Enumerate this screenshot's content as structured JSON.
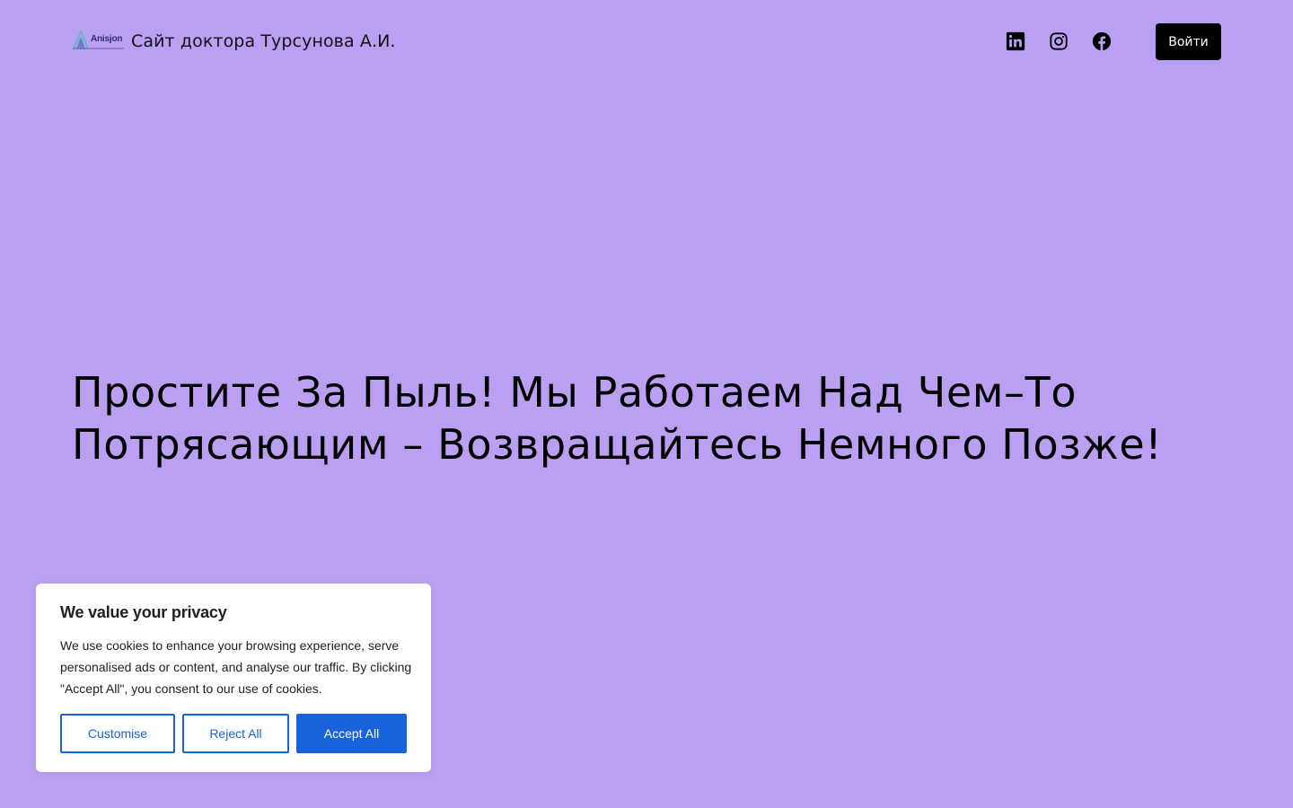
{
  "header": {
    "logo_text": "Anisjon",
    "site_title": "Сайт доктора Турсунова А.И.",
    "social": [
      {
        "icon": "linkedin-icon"
      },
      {
        "icon": "instagram-icon"
      },
      {
        "icon": "facebook-icon"
      }
    ],
    "login_label": "Войти"
  },
  "hero": {
    "heading": "Простите За Пыль! Мы Работаем Над Чем–То Потрясающим – Возвращайтесь Немного Позже!"
  },
  "cookie_banner": {
    "title": "We value your privacy",
    "text": "We use cookies to enhance your browsing experience, serve personalised ads or content, and analyse our traffic. By clicking \"Accept All\", you consent to our use of cookies.",
    "customise_label": "Customise",
    "reject_label": "Reject All",
    "accept_label": "Accept All"
  },
  "colors": {
    "background": "#bb9ff2",
    "button_dark": "#000000",
    "cookie_accent": "#1863dc"
  }
}
